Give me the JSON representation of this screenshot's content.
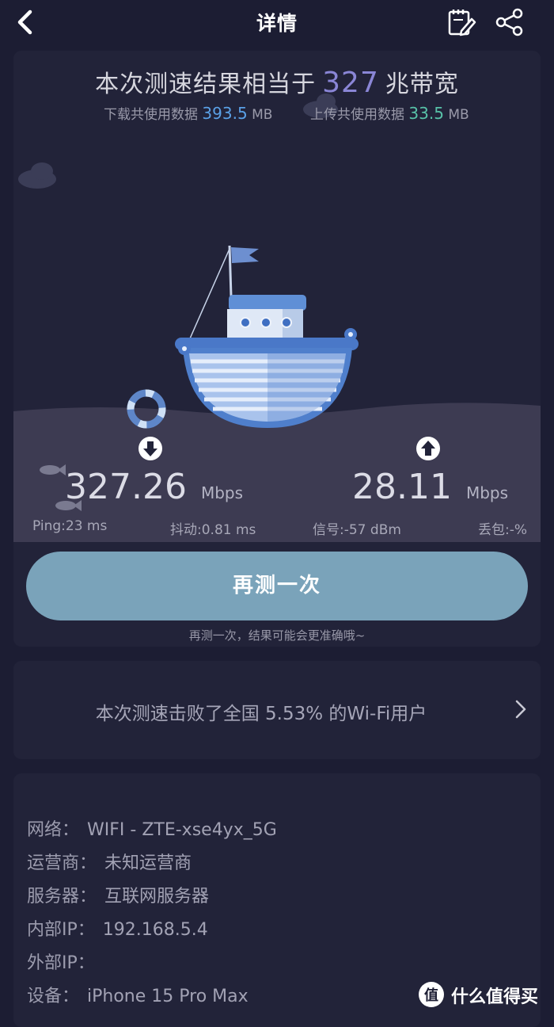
{
  "header": {
    "title": "详情"
  },
  "result": {
    "headline_prefix": "本次测速结果相当于",
    "headline_value": "327",
    "headline_suffix": "兆带宽",
    "download_data_label": "下载共使用数据",
    "download_data_value": "393.5",
    "download_data_unit": "MB",
    "upload_data_label": "上传共使用数据",
    "upload_data_value": "33.5",
    "upload_data_unit": "MB"
  },
  "speeds": {
    "download": "327.26",
    "upload": "28.11",
    "unit": "Mbps"
  },
  "metrics": {
    "ping": "Ping:23 ms",
    "jitter": "抖动:0.81 ms",
    "signal": "信号:-57 dBm",
    "loss": "丢包:-%"
  },
  "actions": {
    "retest_label": "再测一次",
    "retest_hint": "再测一次，结果可能会更准确哦~"
  },
  "rank": {
    "text": "本次测速击败了全国 5.53% 的Wi-Fi用户"
  },
  "info": [
    {
      "key": "网络：",
      "value": "WIFI - ZTE-xse4yx_5G"
    },
    {
      "key": "运营商：",
      "value": "未知运营商"
    },
    {
      "key": "服务器：",
      "value": "互联网服务器"
    },
    {
      "key": "内部IP：",
      "value": "192.168.5.4"
    },
    {
      "key": "外部IP：",
      "value": ""
    },
    {
      "key": "设备：",
      "value": "iPhone 15 Pro Max"
    }
  ],
  "watermark": {
    "text": "什么值得买",
    "logo": "值"
  },
  "colors": {
    "background": "#1c1d33",
    "card": "#222339",
    "accent_purple": "#8a86d6",
    "download_blue": "#5aa0e6",
    "upload_green": "#58c2a8",
    "button": "#7aa3ba"
  },
  "icons": [
    "back-arrow-icon",
    "edit-icon",
    "share-icon",
    "download-arrow-icon",
    "upload-arrow-icon",
    "chevron-right-icon",
    "boat-illustration",
    "cloud-icon",
    "fish-icon",
    "lifebuoy-icon"
  ]
}
